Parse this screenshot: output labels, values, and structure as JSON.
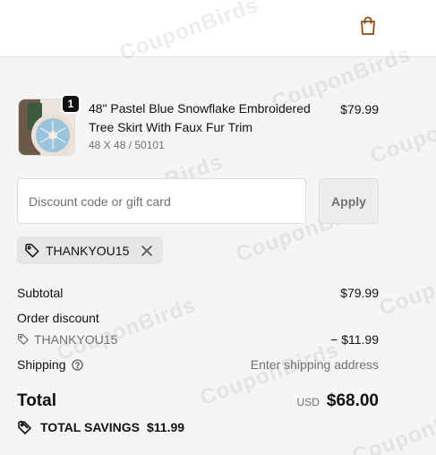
{
  "header": {
    "cart_icon": "shopping-bag-icon",
    "accent_color": "#8a4b12"
  },
  "line_item": {
    "quantity": "1",
    "title": "48\" Pastel Blue Snowflake Embroidered Tree Skirt With Faux Fur Trim",
    "variant": "48 X 48 / 50101",
    "price": "$79.99"
  },
  "discount": {
    "placeholder": "Discount code or gift card",
    "value": "",
    "apply_label": "Apply",
    "applied_code": "THANKYOU15"
  },
  "summary": {
    "subtotal_label": "Subtotal",
    "subtotal_value": "$79.99",
    "order_discount_label": "Order discount",
    "discount_code": "THANKYOU15",
    "discount_value": "− $11.99",
    "shipping_label": "Shipping",
    "shipping_value": "Enter shipping address",
    "total_label": "Total",
    "total_currency": "USD",
    "total_value": "$68.00",
    "savings_label": "TOTAL SAVINGS",
    "savings_value": "$11.99"
  },
  "watermark": {
    "text": "CouponBirds"
  }
}
